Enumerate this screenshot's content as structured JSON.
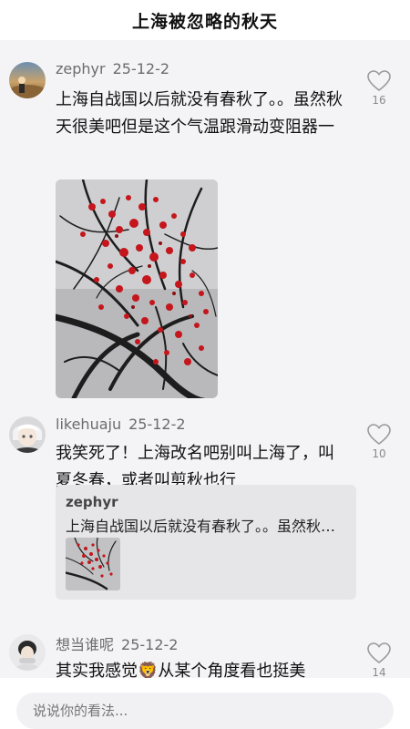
{
  "header": {
    "title": "上海被忽略的秋天"
  },
  "comments": [
    {
      "username": "zephyr",
      "date": "25-12-2",
      "text": "上海自战国以后就没有春秋了。。虽然秋天很美吧但是这个气温跟滑动变阻器一样，每天都在纠结要穿多厚…",
      "likes": "16"
    },
    {
      "username": "likehuaju",
      "date": "25-12-2",
      "text": "我笑死了！上海改名吧别叫上海了，叫夏冬春，或者叫剪秋也行",
      "likes": "10",
      "quote": {
        "username": "zephyr",
        "text": "上海自战国以后就没有春秋了。。虽然秋天很美吧但是这个气温跟滑动变阻器一样"
      }
    },
    {
      "username": "想当谁呢",
      "date": "25-12-2",
      "text_before": "其实我感觉",
      "emoji": "🦁",
      "text_after": "从某个角度看也挺美",
      "likes": "14"
    }
  ],
  "input": {
    "placeholder": "说说你的看法..."
  },
  "colors": {
    "leaf": "#c4161c",
    "meta": "#6b6b6b",
    "quote_bg": "#e6e6e8"
  }
}
